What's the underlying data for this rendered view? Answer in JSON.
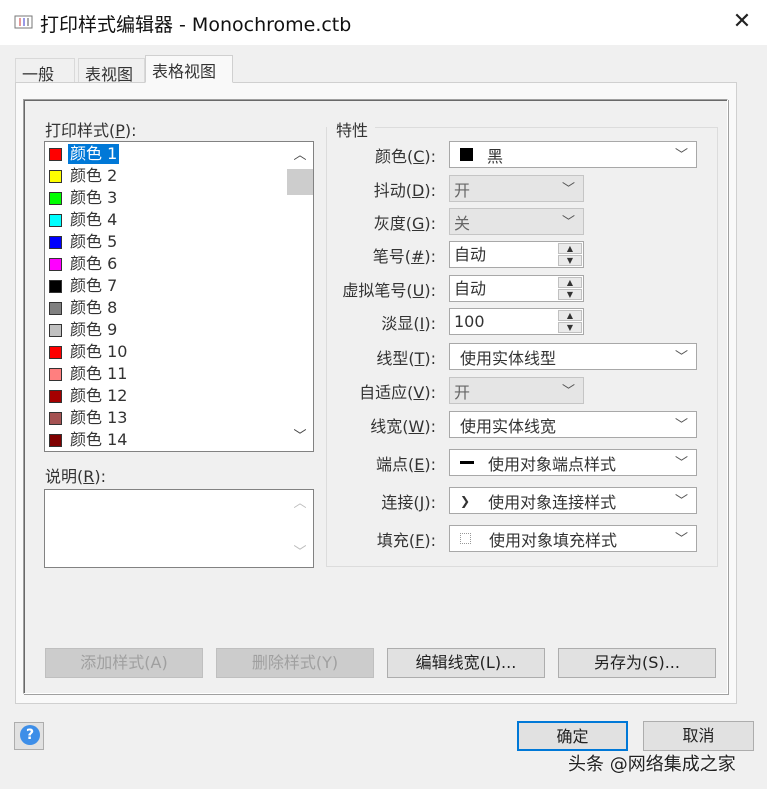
{
  "window": {
    "title": "打印样式编辑器 - Monochrome.ctb",
    "close": "✕"
  },
  "tabs": [
    {
      "label": "一般"
    },
    {
      "label": "表视图"
    },
    {
      "label": "表格视图",
      "selected": true
    }
  ],
  "styles_label": "打印样式(",
  "styles_key": "P",
  "styles_tail": "):",
  "styles": [
    {
      "name": "颜色 1",
      "color": "#ff0000"
    },
    {
      "name": "颜色 2",
      "color": "#ffff00"
    },
    {
      "name": "颜色 3",
      "color": "#00ff00"
    },
    {
      "name": "颜色 4",
      "color": "#00ffff"
    },
    {
      "name": "颜色 5",
      "color": "#0000ff"
    },
    {
      "name": "颜色 6",
      "color": "#ff00ff"
    },
    {
      "name": "颜色 7",
      "color": "#000000"
    },
    {
      "name": "颜色 8",
      "color": "#808080"
    },
    {
      "name": "颜色 9",
      "color": "#c0c0c0"
    },
    {
      "name": "颜色 10",
      "color": "#ff0000"
    },
    {
      "name": "颜色 11",
      "color": "#ff7f7f"
    },
    {
      "name": "颜色 12",
      "color": "#a50000"
    },
    {
      "name": "颜色 13",
      "color": "#a55252"
    },
    {
      "name": "颜色 14",
      "color": "#7f0000"
    }
  ],
  "desc_label": "说明(",
  "desc_key": "R",
  "desc_tail": "):",
  "props_title": "特性",
  "props": {
    "color": {
      "label": "颜色(",
      "key": "C",
      "value": "黑",
      "swatch": "#000000"
    },
    "dither": {
      "label": "抖动(",
      "key": "D",
      "value": "开"
    },
    "gray": {
      "label": "灰度(",
      "key": "G",
      "value": "关"
    },
    "pen": {
      "label": "笔号(",
      "key": "#",
      "value": "自动"
    },
    "vpen": {
      "label": "虚拟笔号(",
      "key": "U",
      "value": "自动"
    },
    "screen": {
      "label": "淡显(",
      "key": "I",
      "value": "100"
    },
    "linetype": {
      "label": "线型(",
      "key": "T",
      "value": "使用实体线型"
    },
    "adaptive": {
      "label": "自适应(",
      "key": "V",
      "value": "开"
    },
    "lineweight": {
      "label": "线宽(",
      "key": "W",
      "value": "使用实体线宽"
    },
    "endstyle": {
      "label": "端点(",
      "key": "E",
      "value": "使用对象端点样式"
    },
    "joinstyle": {
      "label": "连接(",
      "key": "J",
      "value": "使用对象连接样式"
    },
    "fillstyle": {
      "label": "填充(",
      "key": "F",
      "value": "使用对象填充样式"
    }
  },
  "label_tail": "):",
  "buttons": {
    "add": "添加样式(A)",
    "delete": "删除样式(Y)",
    "edit_lw": "编辑线宽(L)...",
    "save_as": "另存为(S)...",
    "ok": "确定",
    "cancel": "取消",
    "help": "?"
  },
  "watermark": "头条 @网络集成之家"
}
